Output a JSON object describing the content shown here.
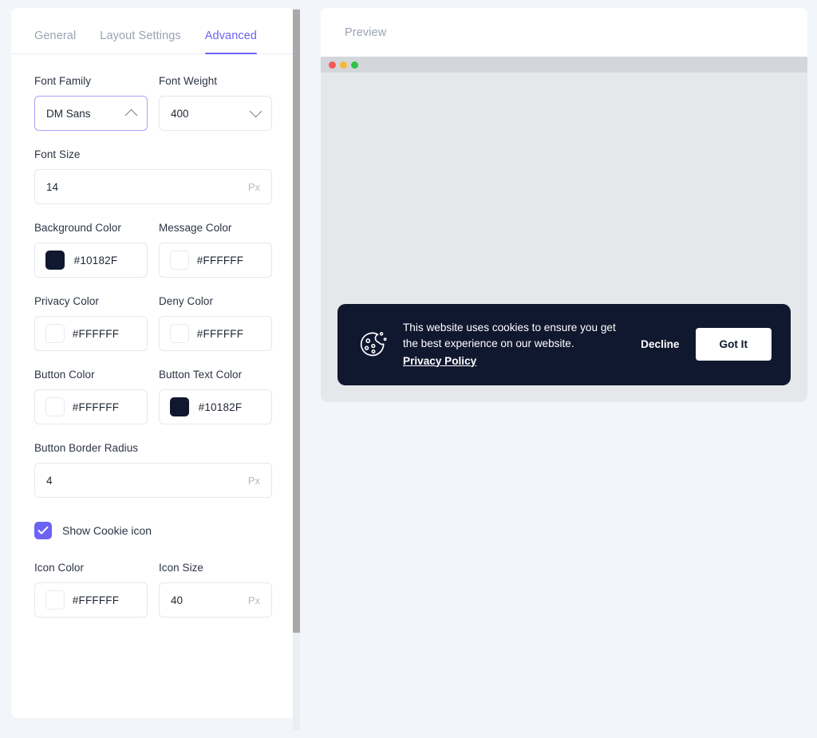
{
  "tabs": [
    {
      "label": "General",
      "active": false
    },
    {
      "label": "Layout Settings",
      "active": false
    },
    {
      "label": "Advanced",
      "active": true
    }
  ],
  "accent_color": "#6C63F2",
  "fields": {
    "font_family": {
      "label": "Font Family",
      "value": "DM Sans",
      "chevron": "chevron-up-icon"
    },
    "font_weight": {
      "label": "Font Weight",
      "value": "400",
      "chevron": "chevron-down-icon"
    },
    "font_size": {
      "label": "Font Size",
      "value": "14",
      "unit": "Px"
    },
    "background_color": {
      "label": "Background Color",
      "value": "#10182F",
      "swatch": "#10182F"
    },
    "message_color": {
      "label": "Message Color",
      "value": "#FFFFFF",
      "swatch": "#FFFFFF"
    },
    "privacy_color": {
      "label": "Privacy Color",
      "value": "#FFFFFF",
      "swatch": "#FFFFFF"
    },
    "deny_color": {
      "label": "Deny Color",
      "value": "#FFFFFF",
      "swatch": "#FFFFFF"
    },
    "button_color": {
      "label": "Button Color",
      "value": "#FFFFFF",
      "swatch": "#FFFFFF"
    },
    "button_text_color": {
      "label": "Button Text Color",
      "value": "#10182F",
      "swatch": "#10182F"
    },
    "button_border_radius": {
      "label": "Button Border Radius",
      "value": "4",
      "unit": "Px"
    },
    "show_cookie_icon": {
      "label": "Show Cookie icon",
      "checked": true
    },
    "icon_color": {
      "label": "Icon Color",
      "value": "#FFFFFF",
      "swatch": "#FFFFFF"
    },
    "icon_size": {
      "label": "Icon Size",
      "value": "40",
      "unit": "Px"
    }
  },
  "preview": {
    "title": "Preview",
    "window_dots": [
      "red",
      "yellow",
      "green"
    ],
    "banner": {
      "message": "This website uses cookies to ensure you get the best experience on our website.",
      "privacy_link": "Privacy Policy",
      "decline_label": "Decline",
      "accept_label": "Got It",
      "background": "#10182F",
      "text_color": "#FFFFFF",
      "button_color": "#FFFFFF",
      "button_text_color": "#10182F",
      "icon": "cookie-icon"
    }
  }
}
